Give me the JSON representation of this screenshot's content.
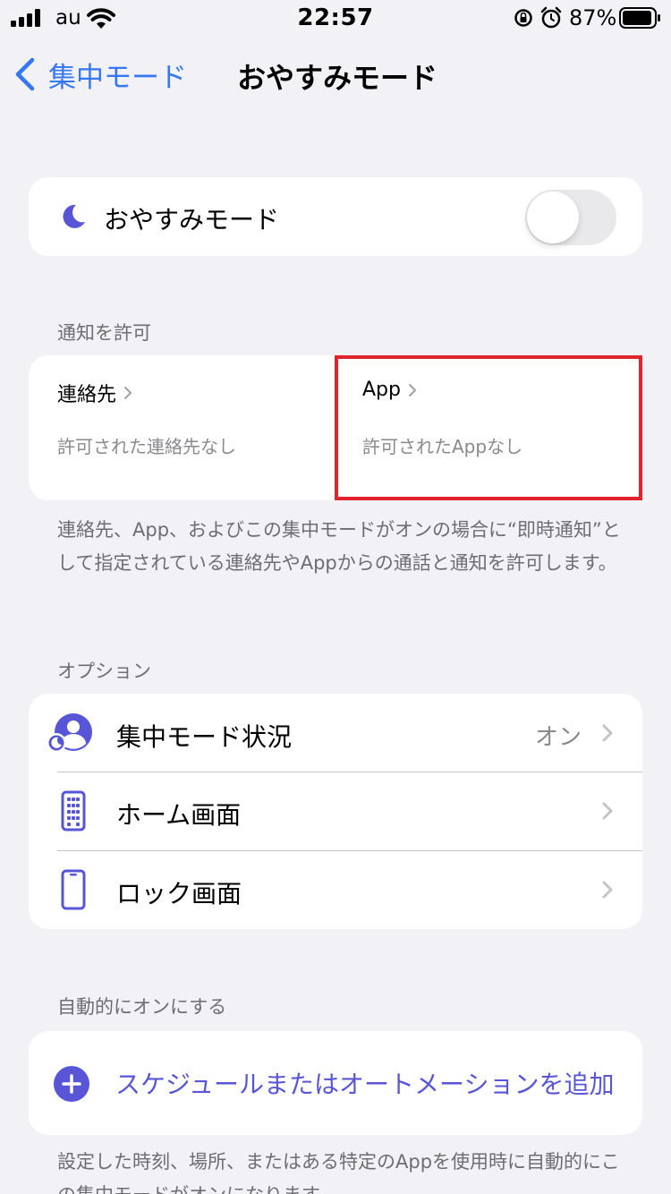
{
  "status_bar": {
    "carrier": "au",
    "time": "22:57",
    "battery": "87%"
  },
  "nav": {
    "back_label": "集中モード",
    "title": "おやすみモード"
  },
  "mode_toggle": {
    "label": "おやすみモード",
    "on": false
  },
  "allow_section": {
    "header": "通知を許可",
    "people": {
      "title": "連絡先",
      "subtitle": "許可された連絡先なし"
    },
    "apps": {
      "title": "App",
      "subtitle": "許可されたAppなし"
    },
    "footnote": "連絡先、App、およびこの集中モードがオンの場合に“即時通知”として指定されている連絡先やAppからの通話と通知を許可します。"
  },
  "options_section": {
    "header": "オプション",
    "items": [
      {
        "label": "集中モード状況",
        "value": "オン"
      },
      {
        "label": "ホーム画面",
        "value": ""
      },
      {
        "label": "ロック画面",
        "value": ""
      }
    ]
  },
  "auto_section": {
    "header": "自動的にオンにする",
    "add_label": "スケジュールまたはオートメーションを追加",
    "footnote": "設定した時刻、場所、またはある特定のAppを使用時に自動的にこの集中モードがオンになります。"
  },
  "colors": {
    "accent_blue": "#3478f6",
    "accent_indigo": "#5856d6",
    "highlight_red": "#e0232d"
  }
}
